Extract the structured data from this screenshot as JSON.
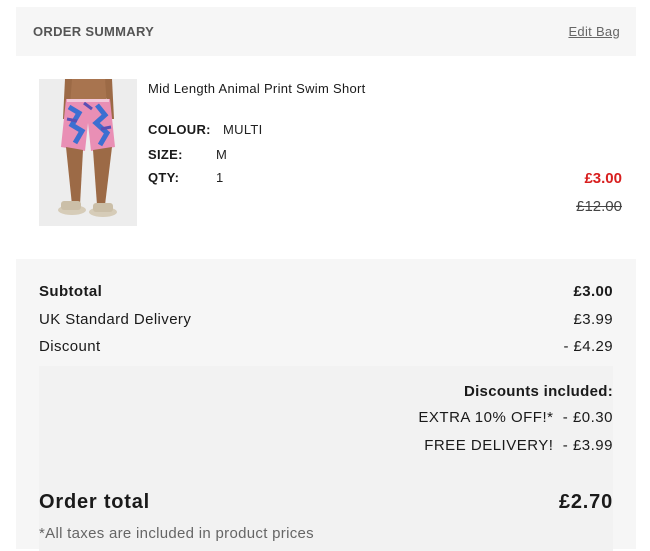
{
  "header": {
    "title": "ORDER SUMMARY",
    "edit_label": "Edit Bag"
  },
  "product": {
    "name": "Mid Length Animal Print Swim Short",
    "colour_label": "COLOUR:",
    "colour_value": "MULTI",
    "size_label": "SIZE:",
    "size_value": "M",
    "qty_label": "QTY:",
    "qty_value": "1",
    "price_now": "£3.00",
    "price_was": "£12.00"
  },
  "totals": {
    "subtotal_label": "Subtotal",
    "subtotal_value": "£3.00",
    "delivery_label": "UK Standard Delivery",
    "delivery_value": "£3.99",
    "discount_label": "Discount",
    "discount_value": "- £4.29",
    "discounts_title": "Discounts included:",
    "discounts": [
      {
        "name": "EXTRA 10% OFF!*",
        "amount": "- £0.30"
      },
      {
        "name": "FREE DELIVERY!",
        "amount": "- £3.99"
      }
    ],
    "order_total_label": "Order total",
    "order_total_value": "£2.70",
    "tax_note": "*All taxes are included in product prices"
  },
  "colors": {
    "sale_price": "#d81e1e",
    "panel_bg": "#f6f6f6"
  }
}
